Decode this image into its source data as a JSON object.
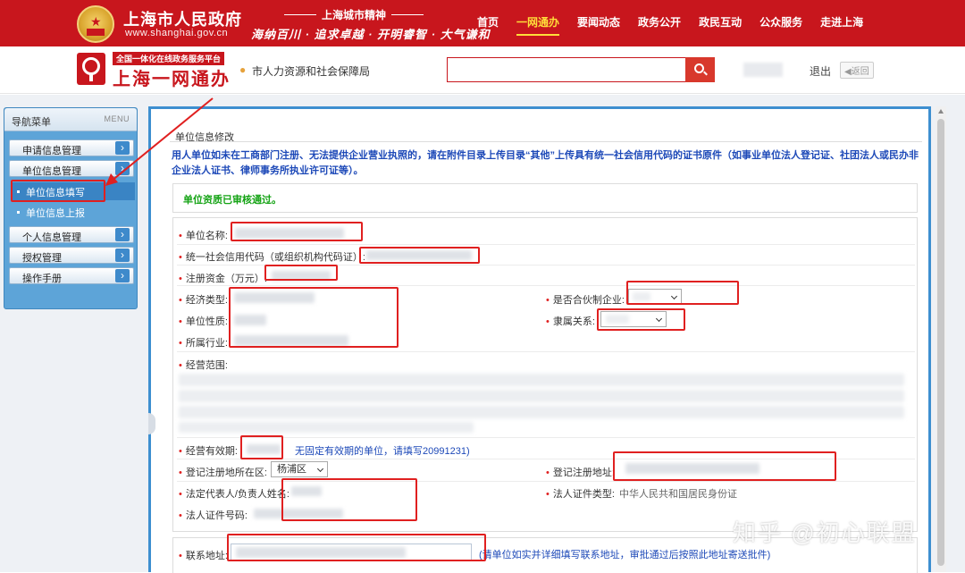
{
  "top": {
    "gov_title": "上海市人民政府",
    "gov_url": "www.shanghai.gov.cn",
    "spirit_title": "上海城市精神",
    "spirit_slogan": "海纳百川 · 追求卓越 · 开明睿智 · 大气谦和",
    "nav": [
      "首页",
      "一网通办",
      "要闻动态",
      "政务公开",
      "政民互动",
      "公众服务",
      "走进上海"
    ],
    "active_nav": "一网通办"
  },
  "subheader": {
    "tagline": "全国一体化在线政务服务平台",
    "brand": "上海一网通办",
    "department": "市人力资源和社会保障局",
    "search_placeholder": "",
    "logout": "退出",
    "back": "返回"
  },
  "sidebar": {
    "title": "导航菜单",
    "menu_label": "MENU",
    "items": [
      {
        "label": "申请信息管理"
      },
      {
        "label": "单位信息管理"
      },
      {
        "label": "单位信息填写",
        "sub": true,
        "active": true
      },
      {
        "label": "单位信息上报",
        "sub": true
      },
      {
        "label": "个人信息管理"
      },
      {
        "label": "授权管理"
      },
      {
        "label": "操作手册"
      }
    ]
  },
  "main": {
    "section_title": "单位信息修改",
    "notice": "用人单位如未在工商部门注册、无法提供企业营业执照的，请在附件目录上传目录“其他”上传具有统一社会信用代码的证书原件（如事业单位法人登记证、社团法人或民办非企业法人证书、律师事务所执业许可证等）。",
    "status": "单位资质已审核通过。",
    "fields": {
      "unit_name": "单位名称:",
      "credit_code": "统一社会信用代码（或组织机构代码证）:",
      "registered_capital": "注册资金（万元）:",
      "economic_type": "经济类型:",
      "unit_nature": "单位性质:",
      "industry": "所属行业:",
      "is_partnership": "是否合伙制企业:",
      "affiliation": "隶属关系:",
      "business_scope": "经营范围:",
      "valid_period": "经营有效期:",
      "valid_period_hint": "无固定有效期的单位，请填写20991231)",
      "reg_district": "登记注册地所在区:",
      "reg_district_value": "杨浦区",
      "reg_address": "登记注册地址:",
      "legal_rep": "法定代表人/负责人姓名:",
      "legal_id_type": "法人证件类型:",
      "legal_id_type_value": "中华人民共和国居民身份证",
      "legal_id_no": "法人证件号码:",
      "contact_address": "联系地址:",
      "contact_hint": "(请单位如实并详细填写联系地址，审批通过后按照此地址寄送批件)"
    }
  },
  "watermark": "知乎 @初心联盟",
  "colors": {
    "header_red": "#c8161d",
    "accent_yellow": "#ffde3a",
    "notice_blue": "#1d49b8",
    "status_green": "#14a314",
    "annotation_red": "#e02020",
    "panel_border": "#3d8fd0"
  }
}
